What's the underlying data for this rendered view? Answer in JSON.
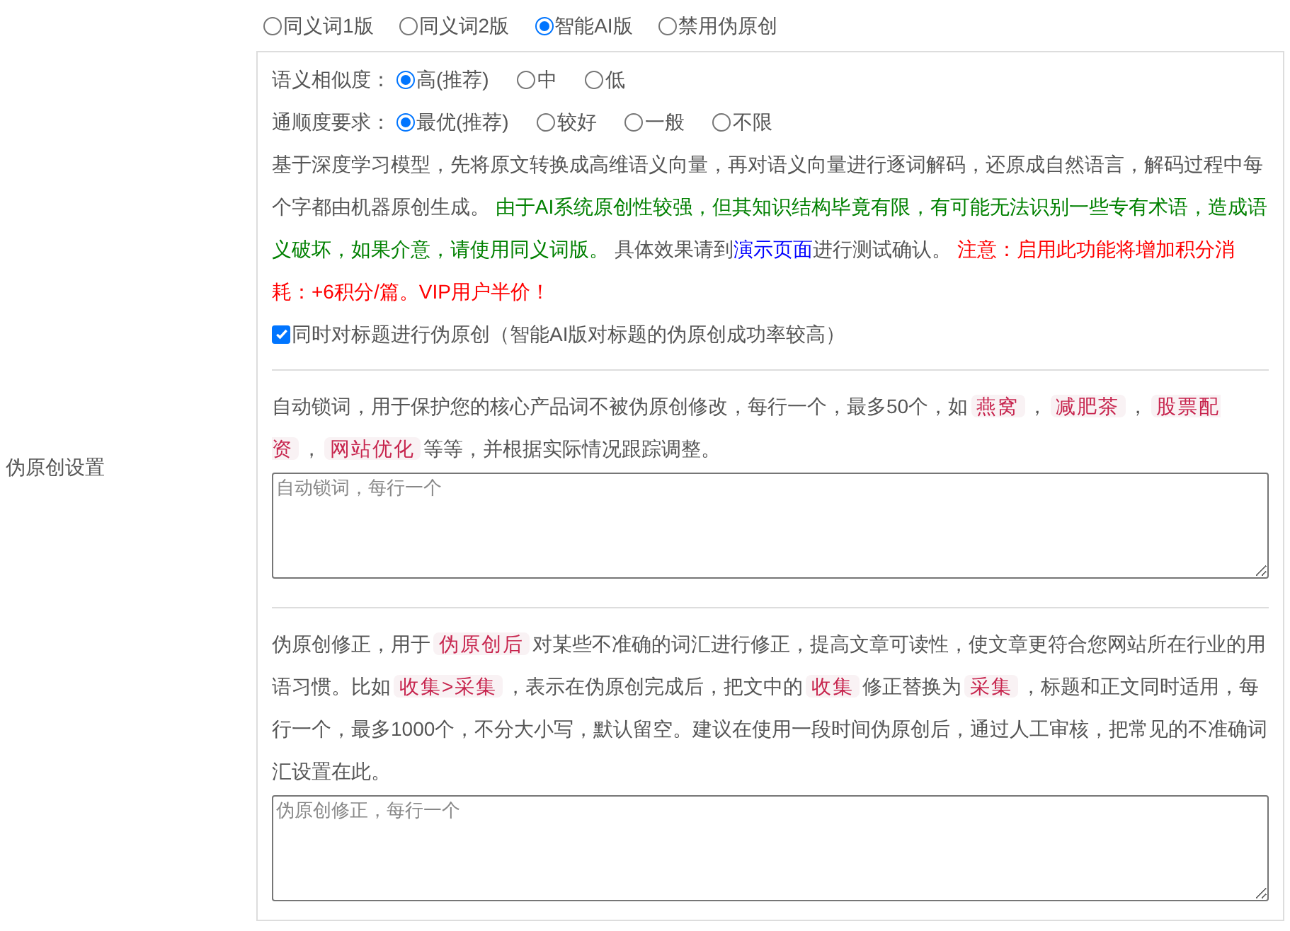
{
  "label": "伪原创设置",
  "modes": [
    {
      "label": "同义词1版",
      "selected": false
    },
    {
      "label": "同义词2版",
      "selected": false
    },
    {
      "label": "智能AI版",
      "selected": true
    },
    {
      "label": "禁用伪原创",
      "selected": false
    }
  ],
  "similarity": {
    "label": "语义相似度：",
    "options": [
      {
        "label": "高(推荐)",
        "selected": true
      },
      {
        "label": "中",
        "selected": false
      },
      {
        "label": "低",
        "selected": false
      }
    ]
  },
  "fluency": {
    "label": "通顺度要求：",
    "options": [
      {
        "label": "最优(推荐)",
        "selected": true
      },
      {
        "label": "较好",
        "selected": false
      },
      {
        "label": "一般",
        "selected": false
      },
      {
        "label": "不限",
        "selected": false
      }
    ]
  },
  "description": [
    {
      "kind": "plain",
      "text": "基于深度学习模型，先将原文转换成高维语义向量，再对语义向量进行逐词解码，还原成自然语言，解码过程中每个字都由机器原创生成。 "
    },
    {
      "kind": "notice",
      "text": "由于AI系统原创性较强，但其知识结构毕竟有限，有可能无法识别一些专有术语，造成语义破坏，如果介意，请使用同义词版。"
    },
    {
      "kind": "plain",
      "text": " 具体效果请到"
    },
    {
      "kind": "link",
      "text": "演示页面"
    },
    {
      "kind": "plain",
      "text": "进行测试确认。 "
    },
    {
      "kind": "warning",
      "text": "注意：启用此功能将增加积分消耗：+6积分/篇。VIP用户半价！"
    }
  ],
  "title_option": {
    "label": "同时对标题进行伪原创（智能AI版对标题的伪原创成功率较高）",
    "checked": true
  },
  "lock_words": {
    "help": [
      {
        "kind": "plain",
        "text": "自动锁词，用于保护您的核心产品词不被伪原创修改，每行一个，最多50个，如"
      },
      {
        "kind": "code",
        "text": "燕窝"
      },
      {
        "kind": "plain",
        "text": "，"
      },
      {
        "kind": "code",
        "text": "减肥茶"
      },
      {
        "kind": "plain",
        "text": "，"
      },
      {
        "kind": "code",
        "text": "股票配资"
      },
      {
        "kind": "plain",
        "text": "，"
      },
      {
        "kind": "code",
        "text": "网站优化"
      },
      {
        "kind": "plain",
        "text": "等等，并根据实际情况跟踪调整。"
      }
    ],
    "placeholder": "自动锁词，每行一个"
  },
  "corrections": {
    "help": [
      {
        "kind": "plain",
        "text": "伪原创修正，用于"
      },
      {
        "kind": "code",
        "text": "伪原创后"
      },
      {
        "kind": "plain",
        "text": "对某些不准确的词汇进行修正，提高文章可读性，使文章更符合您网站所在行业的用语习惯。比如"
      },
      {
        "kind": "code",
        "text": "收集>采集"
      },
      {
        "kind": "plain",
        "text": "，表示在伪原创完成后，把文中的"
      },
      {
        "kind": "code",
        "text": "收集"
      },
      {
        "kind": "plain",
        "text": "修正替换为"
      },
      {
        "kind": "code",
        "text": "采集"
      },
      {
        "kind": "plain",
        "text": "，标题和正文同时适用，每行一个，最多1000个，不分大小写，默认留空。建议在使用一段时间伪原创后，通过人工审核，把常见的不准确词汇设置在此。"
      }
    ],
    "placeholder": "伪原创修正，每行一个"
  }
}
